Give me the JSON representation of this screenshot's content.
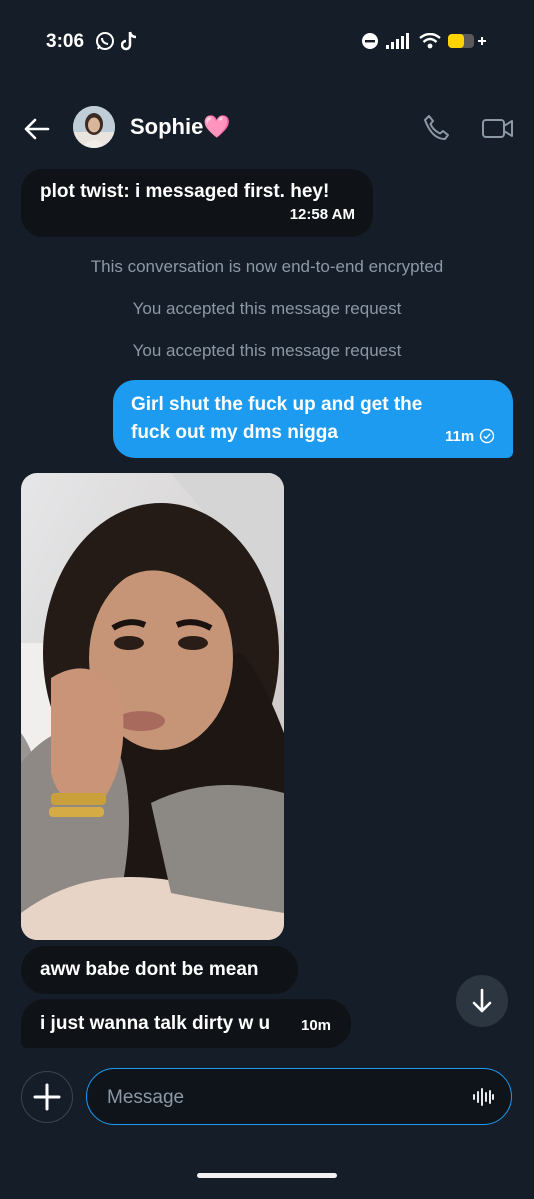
{
  "status": {
    "time": "3:06"
  },
  "header": {
    "contact_name": "Sophie🩷"
  },
  "messages": {
    "first": {
      "text": "plot twist: i messaged first. hey!",
      "time": "12:58 AM"
    },
    "system": [
      "This conversation is now end-to-end encrypted",
      "You accepted this message request",
      "You accepted this message request"
    ],
    "outgoing": {
      "line1": "Girl shut the fuck up and get the",
      "line2": "fuck out my dms nigga",
      "time": "11m"
    },
    "after_photo": [
      {
        "text": "aww babe dont be mean"
      },
      {
        "text": "i just wanna talk dirty w u",
        "time": "10m"
      }
    ]
  },
  "composer": {
    "placeholder": "Message"
  },
  "colors": {
    "background": "#151d28",
    "accent": "#1d9bf0",
    "incoming_bubble": "#0f1216",
    "muted": "#8b98a5"
  }
}
